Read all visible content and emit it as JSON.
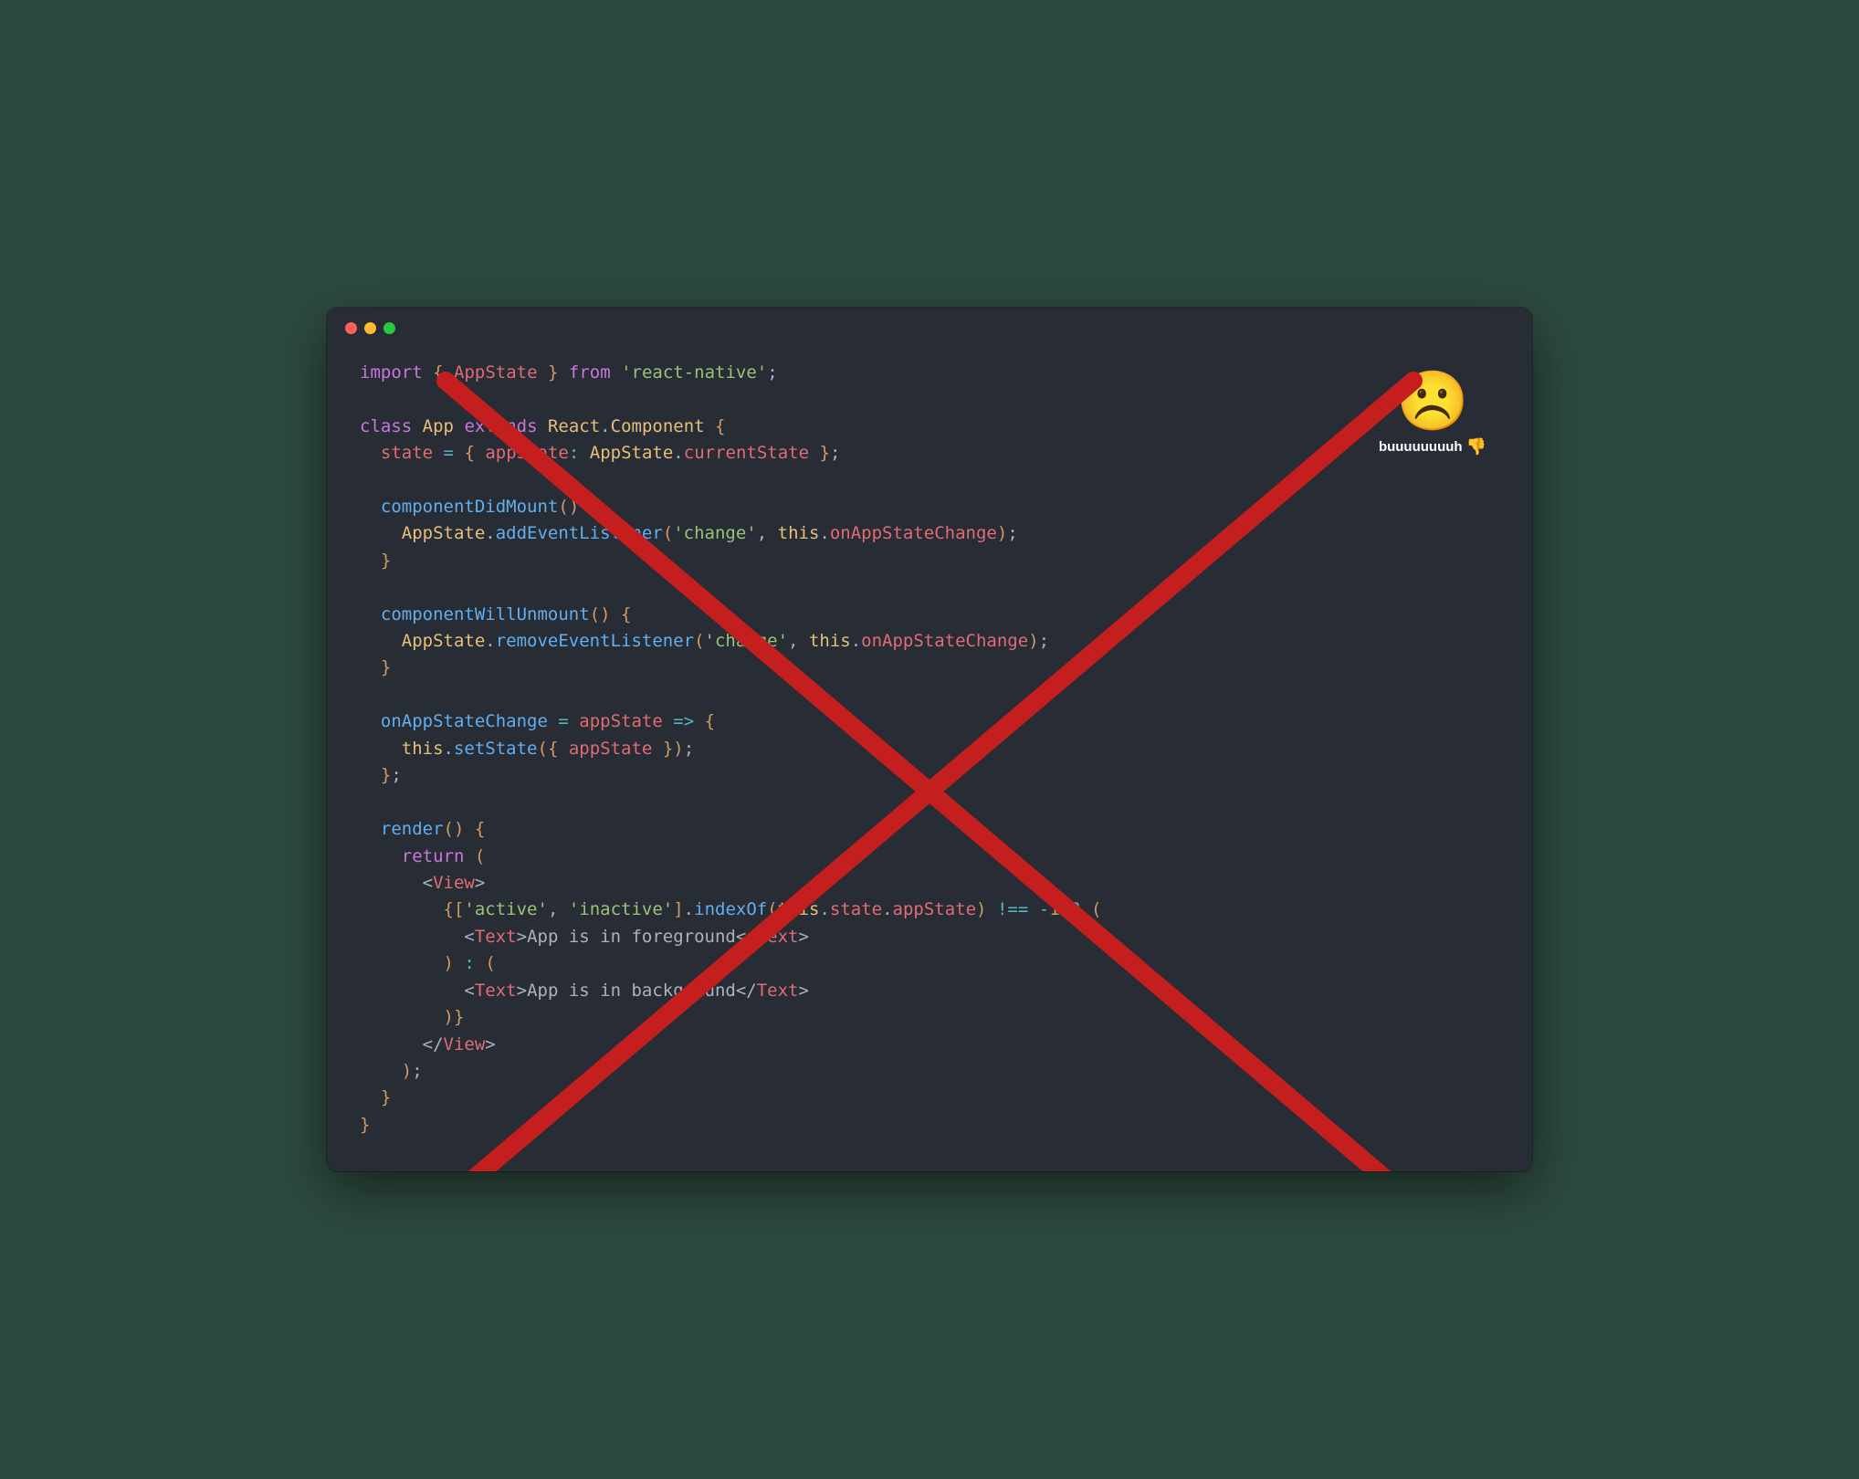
{
  "badge": {
    "emoji": "☹️",
    "label": "buuuuuuuuh",
    "thumb": "👎"
  },
  "code": {
    "lines": [
      [
        [
          "kw",
          "import"
        ],
        [
          "punc",
          " "
        ],
        [
          "brace",
          "{"
        ],
        [
          "punc",
          " "
        ],
        [
          "ident",
          "AppState"
        ],
        [
          "punc",
          " "
        ],
        [
          "brace",
          "}"
        ],
        [
          "punc",
          " "
        ],
        [
          "kw",
          "from"
        ],
        [
          "punc",
          " "
        ],
        [
          "str",
          "'react-native'"
        ],
        [
          "punc",
          ";"
        ]
      ],
      [],
      [
        [
          "kw",
          "class"
        ],
        [
          "punc",
          " "
        ],
        [
          "classname",
          "App"
        ],
        [
          "punc",
          " "
        ],
        [
          "kw",
          "extends"
        ],
        [
          "punc",
          " "
        ],
        [
          "classname",
          "React"
        ],
        [
          "punc",
          "."
        ],
        [
          "classname",
          "Component"
        ],
        [
          "punc",
          " "
        ],
        [
          "brace",
          "{"
        ]
      ],
      [
        [
          "punc",
          "  "
        ],
        [
          "prop",
          "state"
        ],
        [
          "punc",
          " "
        ],
        [
          "op",
          "="
        ],
        [
          "punc",
          " "
        ],
        [
          "brace",
          "{"
        ],
        [
          "punc",
          " "
        ],
        [
          "prop",
          "appState"
        ],
        [
          "op",
          ":"
        ],
        [
          "punc",
          " "
        ],
        [
          "classname",
          "AppState"
        ],
        [
          "punc",
          "."
        ],
        [
          "prop",
          "currentState"
        ],
        [
          "punc",
          " "
        ],
        [
          "brace",
          "}"
        ],
        [
          "punc",
          ";"
        ]
      ],
      [],
      [
        [
          "punc",
          "  "
        ],
        [
          "fn",
          "componentDidMount"
        ],
        [
          "brace",
          "("
        ],
        [
          "brace",
          ")"
        ],
        [
          "punc",
          " "
        ],
        [
          "brace",
          "{"
        ]
      ],
      [
        [
          "punc",
          "    "
        ],
        [
          "classname",
          "AppState"
        ],
        [
          "punc",
          "."
        ],
        [
          "fn",
          "addEventListener"
        ],
        [
          "brace",
          "("
        ],
        [
          "str",
          "'change'"
        ],
        [
          "punc",
          ", "
        ],
        [
          "this",
          "this"
        ],
        [
          "punc",
          "."
        ],
        [
          "prop",
          "onAppStateChange"
        ],
        [
          "brace",
          ")"
        ],
        [
          "punc",
          ";"
        ]
      ],
      [
        [
          "punc",
          "  "
        ],
        [
          "brace",
          "}"
        ]
      ],
      [],
      [
        [
          "punc",
          "  "
        ],
        [
          "fn",
          "componentWillUnmount"
        ],
        [
          "brace",
          "("
        ],
        [
          "brace",
          ")"
        ],
        [
          "punc",
          " "
        ],
        [
          "brace",
          "{"
        ]
      ],
      [
        [
          "punc",
          "    "
        ],
        [
          "classname",
          "AppState"
        ],
        [
          "punc",
          "."
        ],
        [
          "fn",
          "removeEventListener"
        ],
        [
          "brace",
          "("
        ],
        [
          "str",
          "'change'"
        ],
        [
          "punc",
          ", "
        ],
        [
          "this",
          "this"
        ],
        [
          "punc",
          "."
        ],
        [
          "prop",
          "onAppStateChange"
        ],
        [
          "brace",
          ")"
        ],
        [
          "punc",
          ";"
        ]
      ],
      [
        [
          "punc",
          "  "
        ],
        [
          "brace",
          "}"
        ]
      ],
      [],
      [
        [
          "punc",
          "  "
        ],
        [
          "fn",
          "onAppStateChange"
        ],
        [
          "punc",
          " "
        ],
        [
          "op",
          "="
        ],
        [
          "punc",
          " "
        ],
        [
          "ident",
          "appState"
        ],
        [
          "punc",
          " "
        ],
        [
          "op",
          "=>"
        ],
        [
          "punc",
          " "
        ],
        [
          "brace",
          "{"
        ]
      ],
      [
        [
          "punc",
          "    "
        ],
        [
          "this",
          "this"
        ],
        [
          "punc",
          "."
        ],
        [
          "fn",
          "setState"
        ],
        [
          "brace",
          "("
        ],
        [
          "brace",
          "{"
        ],
        [
          "punc",
          " "
        ],
        [
          "prop",
          "appState"
        ],
        [
          "punc",
          " "
        ],
        [
          "brace",
          "}"
        ],
        [
          "brace",
          ")"
        ],
        [
          "punc",
          ";"
        ]
      ],
      [
        [
          "punc",
          "  "
        ],
        [
          "brace",
          "}"
        ],
        [
          "punc",
          ";"
        ]
      ],
      [],
      [
        [
          "punc",
          "  "
        ],
        [
          "fn",
          "render"
        ],
        [
          "brace",
          "("
        ],
        [
          "brace",
          ")"
        ],
        [
          "punc",
          " "
        ],
        [
          "brace",
          "{"
        ]
      ],
      [
        [
          "punc",
          "    "
        ],
        [
          "kw",
          "return"
        ],
        [
          "punc",
          " "
        ],
        [
          "brace",
          "("
        ]
      ],
      [
        [
          "punc",
          "      "
        ],
        [
          "tagbr",
          "<"
        ],
        [
          "tag",
          "View"
        ],
        [
          "tagbr",
          ">"
        ]
      ],
      [
        [
          "punc",
          "        "
        ],
        [
          "brace",
          "{"
        ],
        [
          "brace",
          "["
        ],
        [
          "str",
          "'active'"
        ],
        [
          "punc",
          ", "
        ],
        [
          "str",
          "'inactive'"
        ],
        [
          "brace",
          "]"
        ],
        [
          "punc",
          "."
        ],
        [
          "fn",
          "indexOf"
        ],
        [
          "brace",
          "("
        ],
        [
          "this",
          "this"
        ],
        [
          "punc",
          "."
        ],
        [
          "prop",
          "state"
        ],
        [
          "punc",
          "."
        ],
        [
          "prop",
          "appState"
        ],
        [
          "brace",
          ")"
        ],
        [
          "punc",
          " "
        ],
        [
          "op",
          "!=="
        ],
        [
          "punc",
          " "
        ],
        [
          "op",
          "-"
        ],
        [
          "num",
          "1"
        ],
        [
          "punc",
          " "
        ],
        [
          "op",
          "?"
        ],
        [
          "punc",
          " "
        ],
        [
          "brace",
          "("
        ]
      ],
      [
        [
          "punc",
          "          "
        ],
        [
          "tagbr",
          "<"
        ],
        [
          "tag",
          "Text"
        ],
        [
          "tagbr",
          ">"
        ],
        [
          "text",
          "App is in foreground"
        ],
        [
          "tagbr",
          "</"
        ],
        [
          "tag",
          "Text"
        ],
        [
          "tagbr",
          ">"
        ]
      ],
      [
        [
          "punc",
          "        "
        ],
        [
          "brace",
          ")"
        ],
        [
          "punc",
          " "
        ],
        [
          "op",
          ":"
        ],
        [
          "punc",
          " "
        ],
        [
          "brace",
          "("
        ]
      ],
      [
        [
          "punc",
          "          "
        ],
        [
          "tagbr",
          "<"
        ],
        [
          "tag",
          "Text"
        ],
        [
          "tagbr",
          ">"
        ],
        [
          "text",
          "App is in background"
        ],
        [
          "tagbr",
          "</"
        ],
        [
          "tag",
          "Text"
        ],
        [
          "tagbr",
          ">"
        ]
      ],
      [
        [
          "punc",
          "        "
        ],
        [
          "brace",
          ")"
        ],
        [
          "brace",
          "}"
        ]
      ],
      [
        [
          "punc",
          "      "
        ],
        [
          "tagbr",
          "</"
        ],
        [
          "tag",
          "View"
        ],
        [
          "tagbr",
          ">"
        ]
      ],
      [
        [
          "punc",
          "    "
        ],
        [
          "brace",
          ")"
        ],
        [
          "punc",
          ";"
        ]
      ],
      [
        [
          "punc",
          "  "
        ],
        [
          "brace",
          "}"
        ]
      ],
      [
        [
          "brace",
          "}"
        ]
      ]
    ]
  }
}
